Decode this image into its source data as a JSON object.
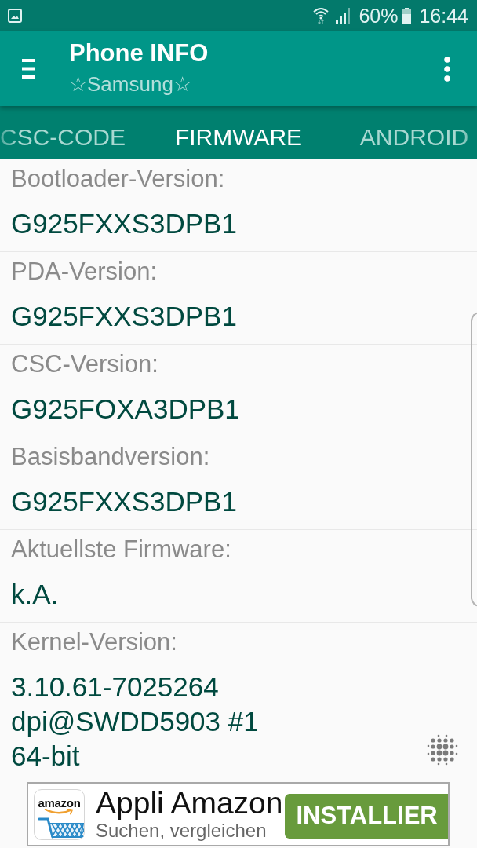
{
  "status_bar": {
    "battery": "60%",
    "time": "16:44"
  },
  "app_bar": {
    "title": "Phone INFO",
    "subtitle": "☆Samsung☆"
  },
  "tabs": [
    {
      "label": "CSC-CODE",
      "selected": false
    },
    {
      "label": "FIRMWARE",
      "selected": true
    },
    {
      "label": "ANDROID",
      "selected": false
    }
  ],
  "rows": [
    {
      "label": "Bootloader-Version:",
      "value": "G925FXXS3DPB1"
    },
    {
      "label": "PDA-Version:",
      "value": "G925FXXS3DPB1"
    },
    {
      "label": "CSC-Version:",
      "value": "G925FOXA3DPB1"
    },
    {
      "label": "Basisbandversion:",
      "value": "G925FXXS3DPB1"
    },
    {
      "label": "Aktuellste Firmware:",
      "value": "k.A."
    },
    {
      "label": "Kernel-Version:",
      "value": "3.10.61-7025264\ndpi@SWDD5903 #1\n64-bit"
    }
  ],
  "ad": {
    "logo_text": "amazon",
    "title": "Appli Amazon",
    "subtitle": "Suchen, vergleichen",
    "button": "INSTALLIER"
  }
}
